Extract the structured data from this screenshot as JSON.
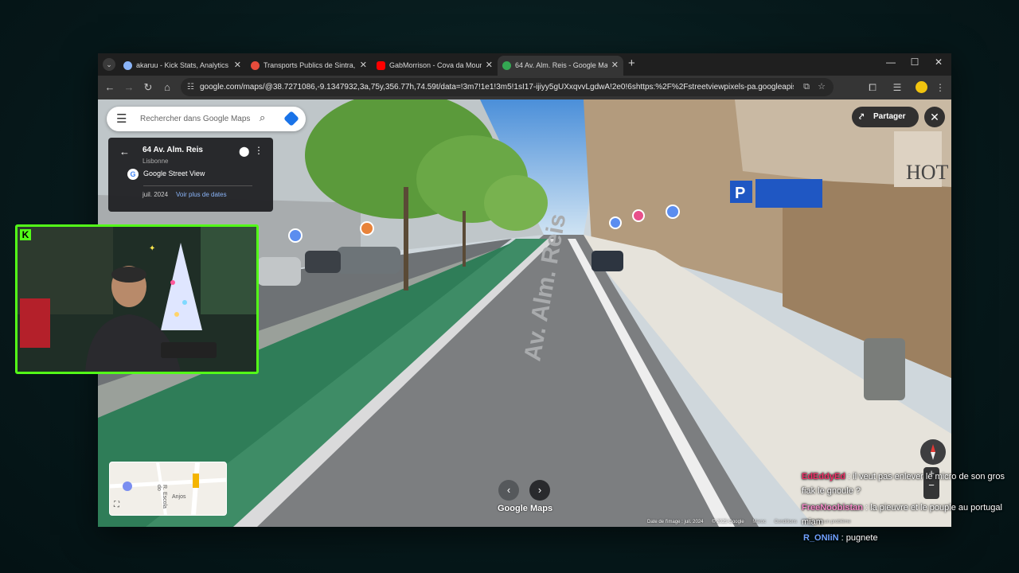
{
  "browser": {
    "tabs": [
      {
        "title": "akaruu - Kick Stats, Analytics an",
        "favicon_color": "#8ab4f8",
        "active": false
      },
      {
        "title": "Transports Publics de Sintra, Po",
        "favicon_color": "#e74c3c",
        "active": false
      },
      {
        "title": "GabMorrison - Cova da Moura",
        "favicon_color": "#ff0000",
        "active": false
      },
      {
        "title": "64 Av. Alm. Reis - Google Maps",
        "favicon_color": "#34a853",
        "active": true
      }
    ],
    "new_tab": "+",
    "url": "google.com/maps/@38.7271086,-9.1347932,3a,75y,356.77h,74.59t/data=!3m7!1e1!3m5!1sI17-ijiyy5gUXxqvvLgdwA!2e0!6shttps:%2F%2Fstreetviewpixels-pa.googleapis.com%2Fv1%2Fthu..."
  },
  "maps": {
    "search_placeholder": "Rechercher dans Google Maps",
    "place_title": "64 Av. Alm. Reis",
    "place_city": "Lisbonne",
    "source": "Google Street View",
    "capture_date": "juil. 2024",
    "more_dates": "Voir plus de dates",
    "share_label": "Partager",
    "street_label": "Av. Alm. Reis",
    "minimap_labels": [
      "R. Escola do",
      "Anjos"
    ],
    "logo": "Google Maps",
    "footer": {
      "image_date": "Date de l'image : juil. 2024",
      "copyright": "© 2025 Google",
      "country": "Maroc",
      "conditions": "Conditions",
      "report": "Signaler un problème"
    }
  },
  "chat": [
    {
      "user": "EdEddyEd",
      "text": "il veut pas enlever le micro de son gros fiak le gnoule ?"
    },
    {
      "user": "FreeNoobistan",
      "text": "la pieuvre et le pouple au portugal miam"
    },
    {
      "user": "R_ONIiN",
      "text": "pugnete"
    }
  ]
}
